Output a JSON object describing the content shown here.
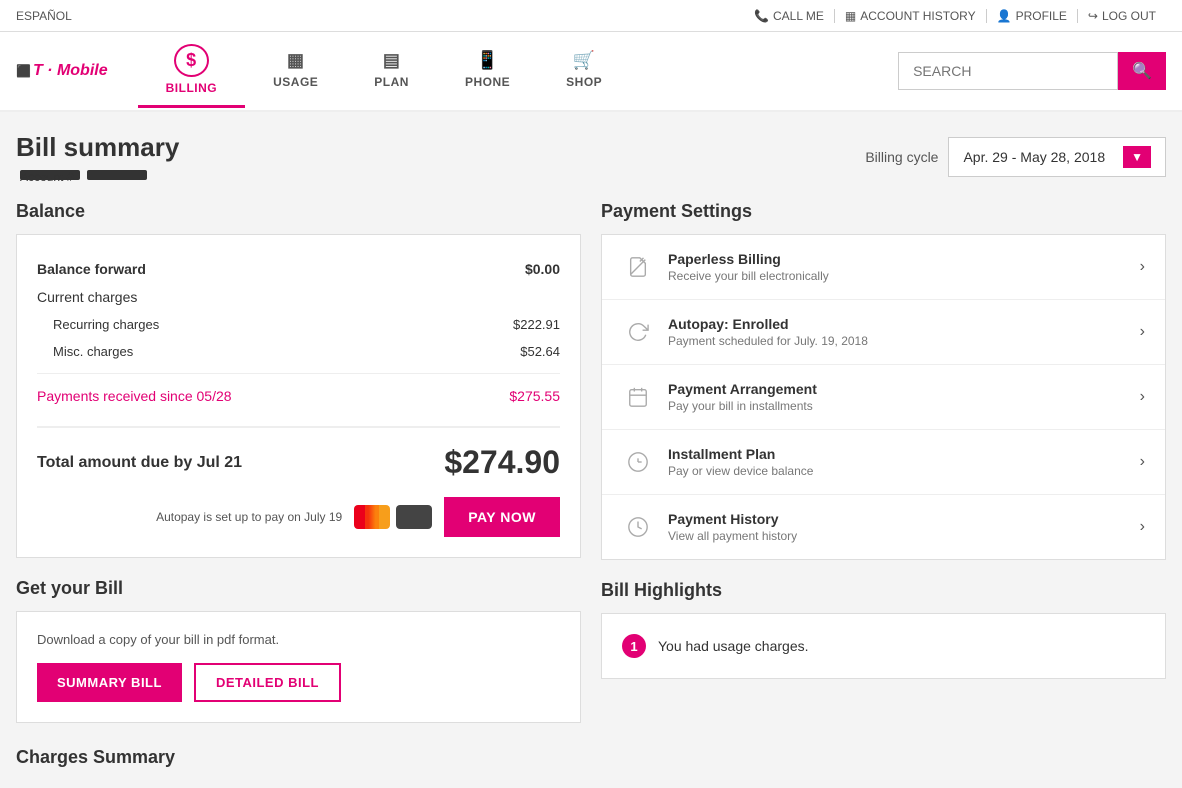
{
  "topbar": {
    "language": "ESPAÑOL",
    "call_me": "CALL ME",
    "account_history": "ACCOUNT HISTORY",
    "profile": "PROFILE",
    "log_out": "LOG OUT"
  },
  "nav": {
    "logo": "T · Mobile",
    "items": [
      {
        "id": "billing",
        "label": "BILLING",
        "active": true,
        "icon": "$"
      },
      {
        "id": "usage",
        "label": "USAGE",
        "active": false,
        "icon": "▦"
      },
      {
        "id": "plan",
        "label": "PLAN",
        "active": false,
        "icon": "▤"
      },
      {
        "id": "phone",
        "label": "PHONE",
        "active": false,
        "icon": "📱"
      },
      {
        "id": "shop",
        "label": "SHOP",
        "active": false,
        "icon": "🛒"
      }
    ],
    "search_placeholder": "SEARCH"
  },
  "page": {
    "title": "Bill summary",
    "account_label": "Account #",
    "billing_cycle_label": "Billing cycle",
    "billing_cycle_value": "Apr. 29 - May 28, 2018"
  },
  "balance": {
    "section_title": "Balance",
    "balance_forward_label": "Balance forward",
    "balance_forward_value": "$0.00",
    "current_charges_label": "Current charges",
    "recurring_charges_label": "Recurring charges",
    "recurring_charges_value": "$222.91",
    "misc_charges_label": "Misc. charges",
    "misc_charges_value": "$52.64",
    "payments_label": "Payments received since 05/28",
    "payments_value": "$275.55",
    "total_label": "Total amount due by Jul 21",
    "total_value": "$274.90",
    "autopay_text": "Autopay is set up to pay on July 19",
    "pay_now_label": "PAY NOW"
  },
  "payment_settings": {
    "section_title": "Payment Settings",
    "items": [
      {
        "id": "paperless",
        "title": "Paperless Billing",
        "desc": "Receive your bill electronically",
        "icon": "no-icon"
      },
      {
        "id": "autopay",
        "title": "Autopay: Enrolled",
        "desc": "Payment scheduled for July. 19, 2018",
        "icon": "refresh-icon"
      },
      {
        "id": "arrangement",
        "title": "Payment Arrangement",
        "desc": "Pay your bill in installments",
        "icon": "calendar-icon"
      },
      {
        "id": "installment",
        "title": "Installment Plan",
        "desc": "Pay or view device balance",
        "icon": "dollar-icon"
      },
      {
        "id": "history",
        "title": "Payment History",
        "desc": "View all payment history",
        "icon": "history-icon"
      }
    ]
  },
  "get_bill": {
    "section_title": "Get your Bill",
    "desc": "Download a copy of your bill in pdf format.",
    "summary_label": "SUMMARY BILL",
    "detailed_label": "DETAILED BILL"
  },
  "highlights": {
    "section_title": "Bill Highlights",
    "items": [
      {
        "badge": "1",
        "text": "You had usage charges."
      }
    ]
  },
  "charges_summary": {
    "title": "Charges Summary"
  }
}
